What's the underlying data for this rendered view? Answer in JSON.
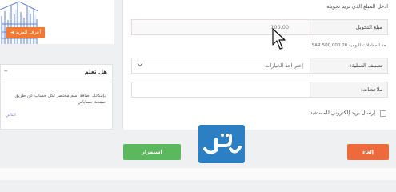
{
  "sidebar": {
    "more_button": "أعرف المزيد ◄",
    "know_title": "هل تعلم",
    "know_collapse": "–",
    "know_body": "بإمكانك إضافة اسم مختصر لكل حساب عن طريق صفحة حساباتي",
    "know_next": "التالي"
  },
  "form": {
    "instruction": "ادخل المبلغ الذي تريد تحويله",
    "amount_label": "مبلغ التحويل",
    "amount_value": "100.00",
    "daily_limit": "حد المعاملات اليومية SAR 500,000.00",
    "category_label": "تصنيف العملية:",
    "category_value": "إختر احد الخيارات",
    "notes_label": "ملاحظات:",
    "notes_value": "",
    "email_checkbox_label": "إرسال بريد إلكتروني للمستفيد"
  },
  "actions": {
    "continue_label": "استمرار",
    "cancel_label": "إلغاء"
  },
  "colors": {
    "orange": "#ec6a3c",
    "green": "#5cb85c",
    "logo_blue": "#2b7fc2"
  }
}
